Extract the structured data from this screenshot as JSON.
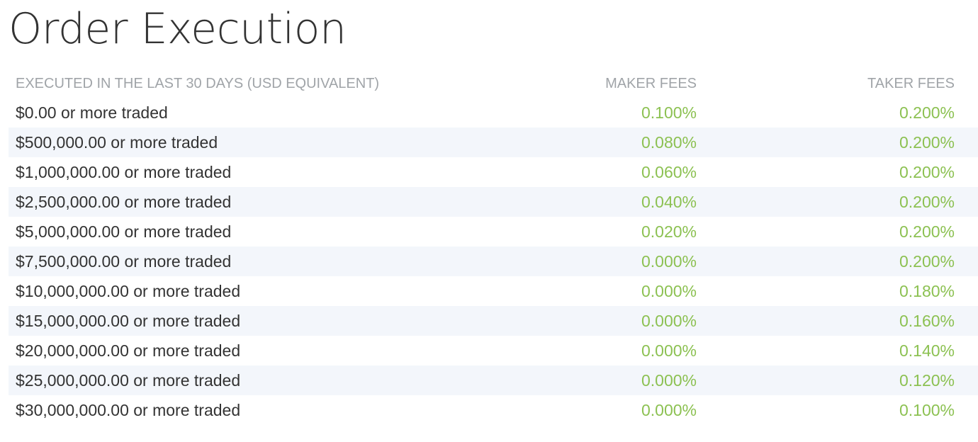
{
  "page": {
    "title": "Order Execution"
  },
  "table": {
    "headers": {
      "volume": "EXECUTED IN THE LAST 30 DAYS (USD EQUIVALENT)",
      "maker": "MAKER FEES",
      "taker": "TAKER FEES"
    },
    "rows": [
      {
        "volume": "$0.00 or more traded",
        "maker": "0.100%",
        "taker": "0.200%"
      },
      {
        "volume": "$500,000.00 or more traded",
        "maker": "0.080%",
        "taker": "0.200%"
      },
      {
        "volume": "$1,000,000.00 or more traded",
        "maker": "0.060%",
        "taker": "0.200%"
      },
      {
        "volume": "$2,500,000.00 or more traded",
        "maker": "0.040%",
        "taker": "0.200%"
      },
      {
        "volume": "$5,000,000.00 or more traded",
        "maker": "0.020%",
        "taker": "0.200%"
      },
      {
        "volume": "$7,500,000.00 or more traded",
        "maker": "0.000%",
        "taker": "0.200%"
      },
      {
        "volume": "$10,000,000.00 or more traded",
        "maker": "0.000%",
        "taker": "0.180%"
      },
      {
        "volume": "$15,000,000.00 or more traded",
        "maker": "0.000%",
        "taker": "0.160%"
      },
      {
        "volume": "$20,000,000.00 or more traded",
        "maker": "0.000%",
        "taker": "0.140%"
      },
      {
        "volume": "$25,000,000.00 or more traded",
        "maker": "0.000%",
        "taker": "0.120%"
      },
      {
        "volume": "$30,000,000.00 or more traded",
        "maker": "0.000%",
        "taker": "0.100%"
      }
    ]
  },
  "colors": {
    "title": "#333333",
    "header_text": "#a0a4a8",
    "body_text": "#333333",
    "fee_text": "#8cc152",
    "striped_row": "#f3f6fb",
    "background": "#ffffff"
  }
}
